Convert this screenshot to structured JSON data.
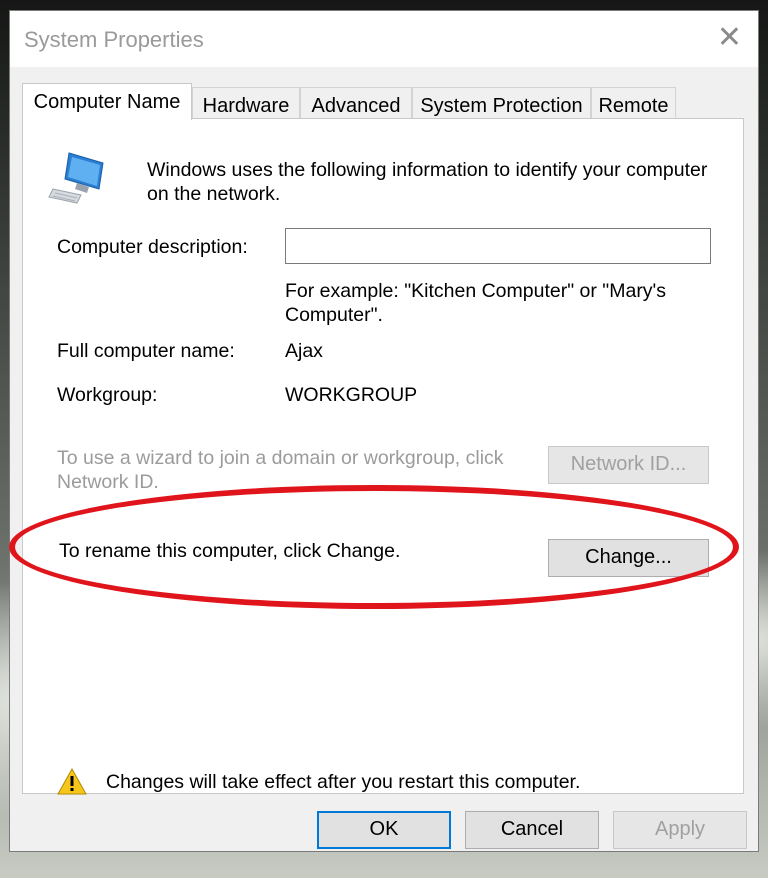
{
  "window": {
    "title": "System Properties",
    "close_glyph": "✕"
  },
  "tabs": [
    {
      "label": "Computer Name",
      "active": true
    },
    {
      "label": "Hardware",
      "active": false
    },
    {
      "label": "Advanced",
      "active": false
    },
    {
      "label": "System Protection",
      "active": false
    },
    {
      "label": "Remote",
      "active": false
    }
  ],
  "content": {
    "intro_line1": "Windows uses the following information to identify your computer",
    "intro_line2": "on the network.",
    "computer_description_label": "Computer description:",
    "computer_description_value": "",
    "example_line1": "For example: \"Kitchen Computer\" or \"Mary's",
    "example_line2": "Computer\".",
    "full_name_label": "Full computer name:",
    "full_name_value": "Ajax",
    "workgroup_label": "Workgroup:",
    "workgroup_value": "WORKGROUP",
    "wizard_line1": "To use a wizard to join a domain or workgroup, click",
    "wizard_line2": "Network ID.",
    "network_id_button": "Network ID...",
    "rename_text": "To rename this computer, click Change.",
    "change_button": "Change...",
    "restart_warning": "Changes will take effect after you restart this computer."
  },
  "footer": {
    "ok": "OK",
    "cancel": "Cancel",
    "apply": "Apply"
  },
  "icons": {
    "computer": "computer-icon",
    "warning": "warning-icon"
  },
  "colors": {
    "highlight_oval": "#e0141b",
    "default_button_border": "#0078d7",
    "disabled_text": "#9b9b9b"
  }
}
